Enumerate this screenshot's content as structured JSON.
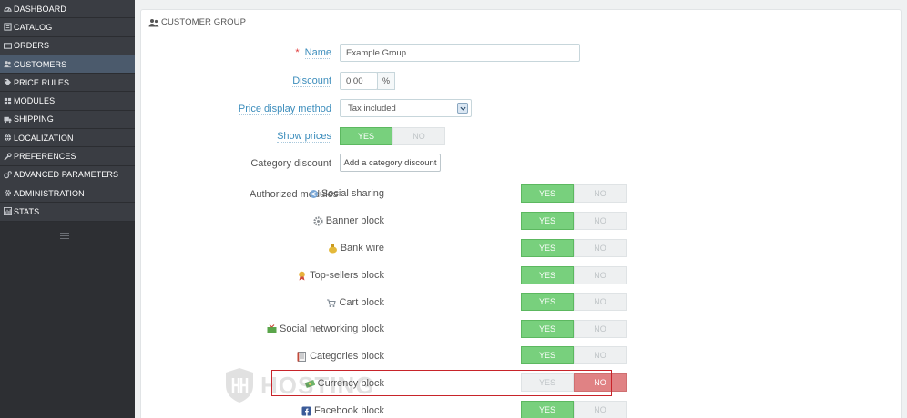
{
  "sidebar": {
    "items": [
      {
        "label": "DASHBOARD",
        "icon": "dashboard-icon",
        "active": false
      },
      {
        "label": "CATALOG",
        "icon": "catalog-icon",
        "active": false
      },
      {
        "label": "ORDERS",
        "icon": "orders-icon",
        "active": false
      },
      {
        "label": "CUSTOMERS",
        "icon": "customers-icon",
        "active": true
      },
      {
        "label": "PRICE RULES",
        "icon": "price-rules-icon",
        "active": false
      },
      {
        "label": "MODULES",
        "icon": "modules-icon",
        "active": false
      },
      {
        "label": "SHIPPING",
        "icon": "shipping-icon",
        "active": false
      },
      {
        "label": "LOCALIZATION",
        "icon": "localization-icon",
        "active": false
      },
      {
        "label": "PREFERENCES",
        "icon": "preferences-icon",
        "active": false
      },
      {
        "label": "ADVANCED PARAMETERS",
        "icon": "advanced-parameters-icon",
        "active": false
      },
      {
        "label": "ADMINISTRATION",
        "icon": "administration-icon",
        "active": false
      },
      {
        "label": "STATS",
        "icon": "stats-icon",
        "active": false
      }
    ]
  },
  "panel": {
    "title": "CUSTOMER GROUP",
    "title_icon": "users-icon"
  },
  "form": {
    "name_required_mark": "*",
    "name_label": "Name",
    "name_value": "Example Group",
    "discount_label": "Discount",
    "discount_value": "0.00",
    "discount_unit": "%",
    "price_method_label": "Price display method",
    "price_method_value": "Tax included",
    "show_prices_label": "Show prices",
    "show_prices_value": "YES",
    "yes_label": "YES",
    "no_label": "NO",
    "category_discount_label": "Category discount",
    "category_discount_button": "Add a category discount",
    "authorized_modules_label": "Authorized modules"
  },
  "modules": [
    {
      "name": "Social sharing",
      "icon": "social-sharing-icon",
      "enabled": true
    },
    {
      "name": "Banner block",
      "icon": "banner-block-icon",
      "enabled": true
    },
    {
      "name": "Bank wire",
      "icon": "bank-wire-icon",
      "enabled": true
    },
    {
      "name": "Top-sellers block",
      "icon": "top-sellers-icon",
      "enabled": true
    },
    {
      "name": "Cart block",
      "icon": "cart-block-icon",
      "enabled": true
    },
    {
      "name": "Social networking block",
      "icon": "social-networking-icon",
      "enabled": true
    },
    {
      "name": "Categories block",
      "icon": "categories-block-icon",
      "enabled": true
    },
    {
      "name": "Currency block",
      "icon": "currency-block-icon",
      "enabled": false
    },
    {
      "name": "Facebook block",
      "icon": "facebook-block-icon",
      "enabled": true
    }
  ],
  "watermark": {
    "text": "HOSTING"
  },
  "colors": {
    "sidebar_bg": "#3a3d43",
    "sidebar_active": "#4b5a6c",
    "switch_yes": "#78d07d",
    "switch_no": "#e08284",
    "link_label": "#3c8dbc",
    "highlight": "#c8242a"
  }
}
